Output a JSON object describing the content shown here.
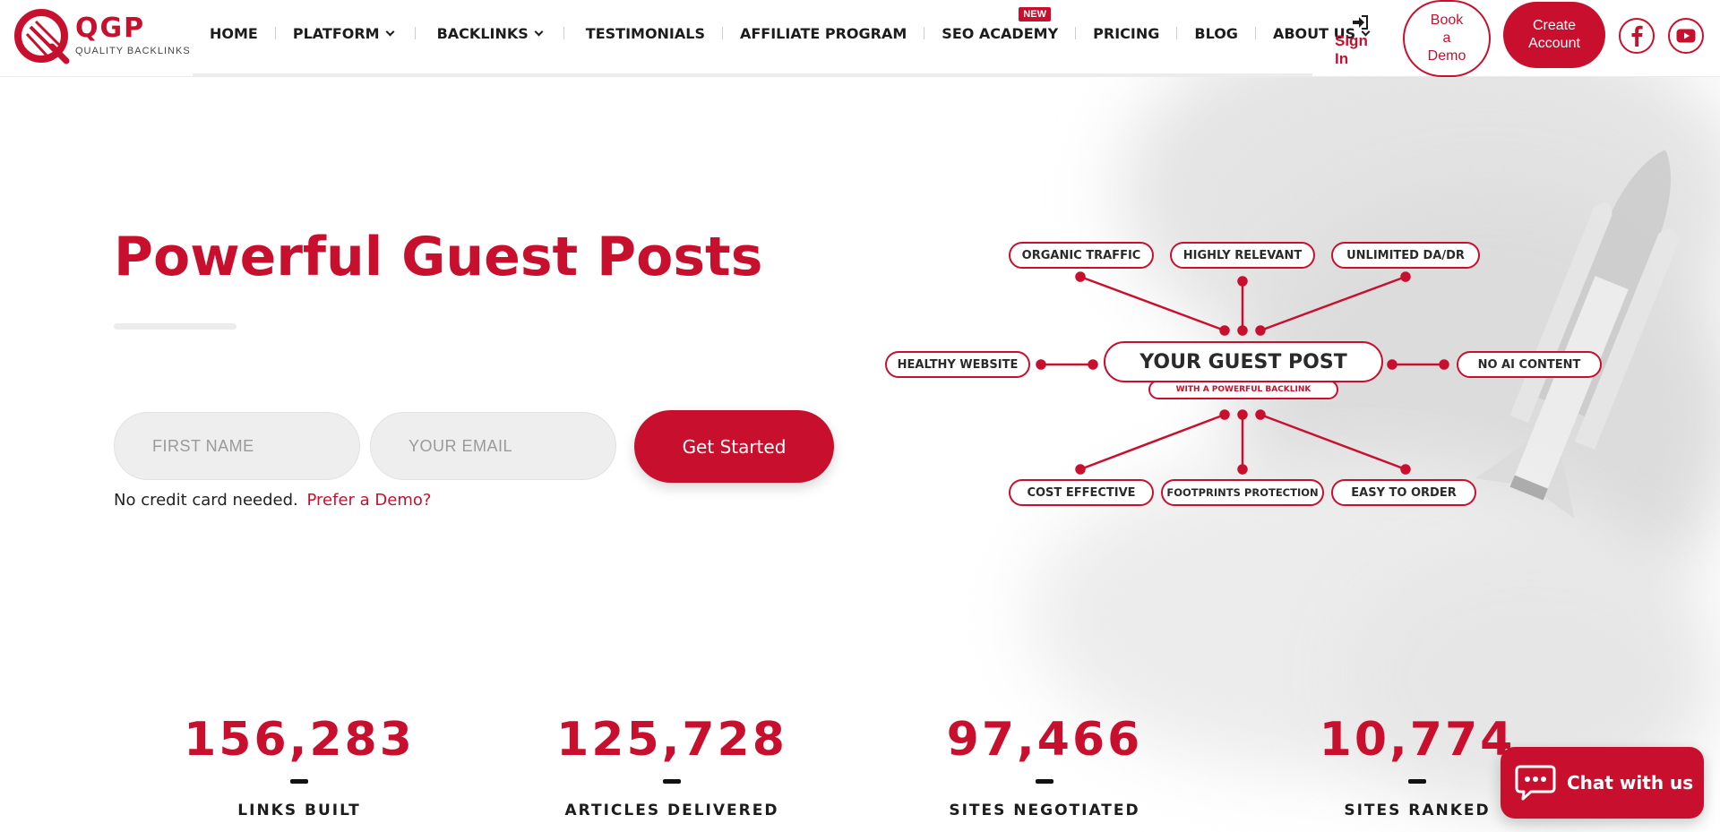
{
  "brand": {
    "name": "QGP",
    "tagline": "QUALITY BACKLINKS",
    "accent_color": "#c8102e"
  },
  "nav": {
    "items": [
      {
        "label": "HOME",
        "has_dropdown": false
      },
      {
        "label": "PLATFORM",
        "has_dropdown": true
      },
      {
        "label": "BACKLINKS",
        "has_dropdown": true
      },
      {
        "label": "TESTIMONIALS",
        "has_dropdown": false
      },
      {
        "label": "AFFILIATE PROGRAM",
        "has_dropdown": false
      },
      {
        "label": "SEO ACADEMY",
        "has_dropdown": false,
        "badge": "NEW"
      },
      {
        "label": "PRICING",
        "has_dropdown": false
      },
      {
        "label": "BLOG",
        "has_dropdown": false
      },
      {
        "label": "ABOUT US",
        "has_dropdown": true
      }
    ],
    "sign_in": "Sign In",
    "book_demo": [
      "Book",
      "a",
      "Demo"
    ],
    "create_account": [
      "Create",
      "Account"
    ],
    "social_icons": [
      "facebook-icon",
      "youtube-icon"
    ]
  },
  "hero": {
    "title": "Powerful Guest Posts",
    "form": {
      "first_name_placeholder": "FIRST NAME",
      "email_placeholder": "YOUR EMAIL",
      "submit_label": "Get Started"
    },
    "note": "No credit card needed.",
    "note_link": "Prefer a Demo?"
  },
  "diagram": {
    "center": "YOUR GUEST POST",
    "center_sub": "WITH A POWERFUL BACKLINK",
    "top": [
      "ORGANIC TRAFFIC",
      "HIGHLY RELEVANT",
      "UNLIMITED DA/DR"
    ],
    "left": "HEALTHY WEBSITE",
    "right": "NO AI CONTENT",
    "bottom": [
      "COST EFFECTIVE",
      "FOOTPRINTS PROTECTION",
      "EASY TO ORDER"
    ]
  },
  "stats": [
    {
      "value": "156,283",
      "label": "LINKS BUILT"
    },
    {
      "value": "125,728",
      "label": "ARTICLES DELIVERED"
    },
    {
      "value": "97,466",
      "label": "SITES NEGOTIATED"
    },
    {
      "value": "10,774",
      "label": "SITES RANKED"
    }
  ],
  "chat": {
    "label": "Chat with us"
  }
}
